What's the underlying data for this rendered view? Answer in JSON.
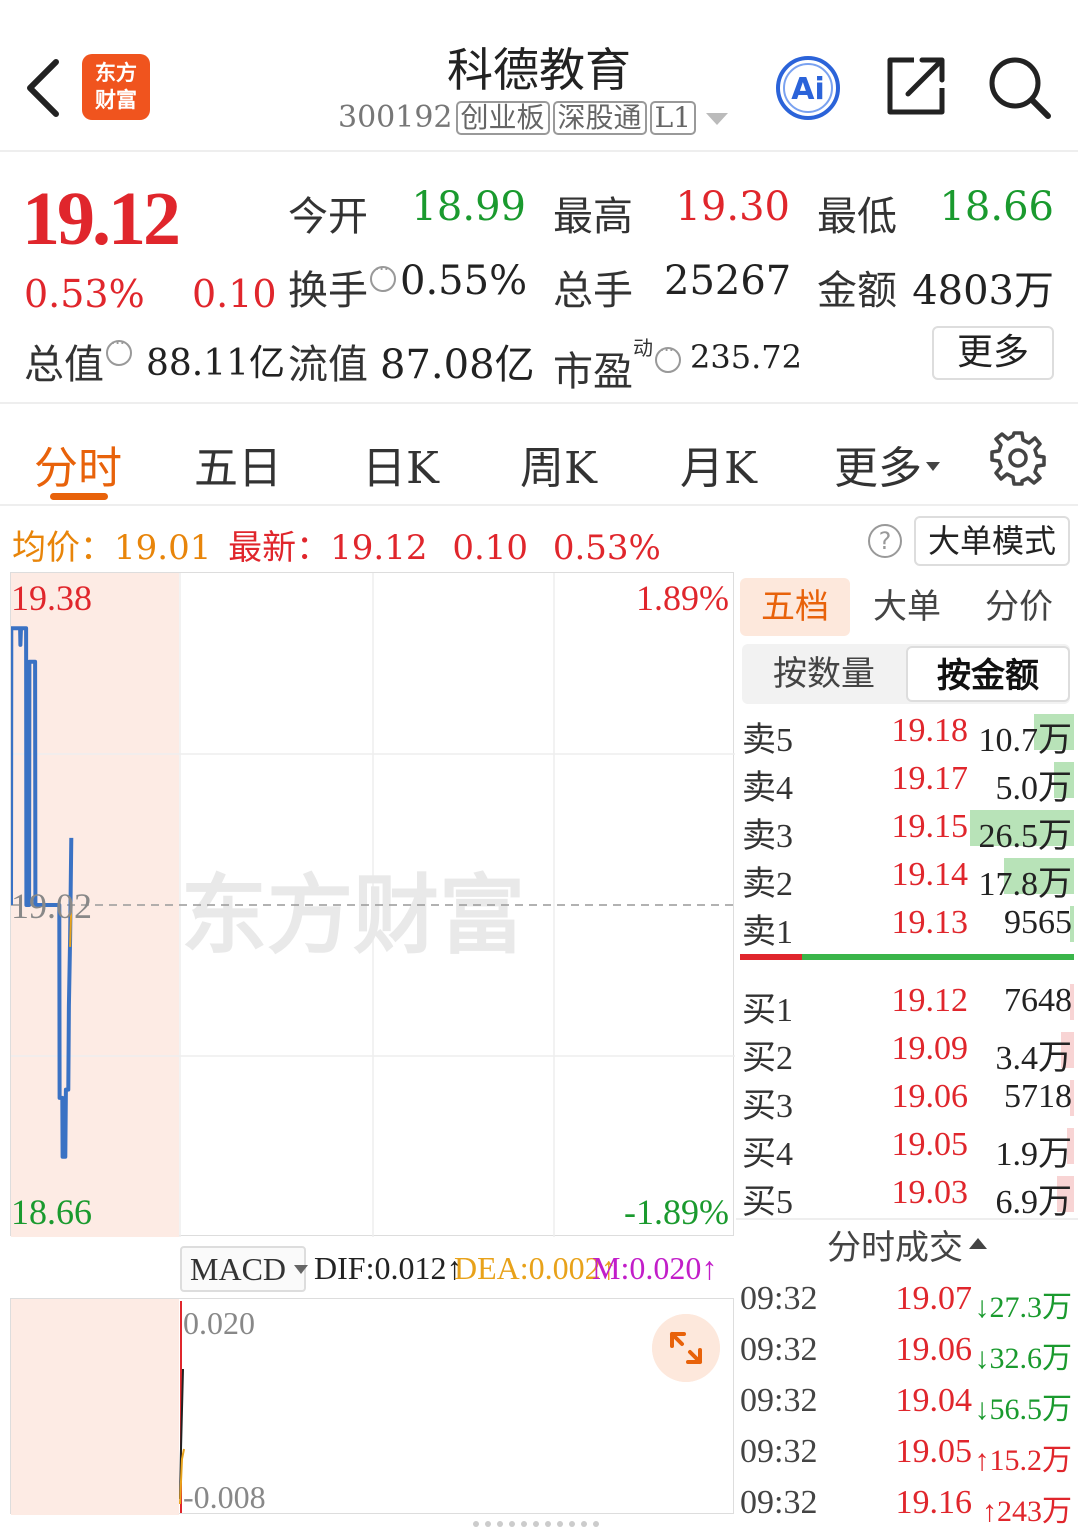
{
  "header": {
    "logo_line1": "东方",
    "logo_line2": "财富",
    "title": "科德教育",
    "code": "300192",
    "tags": [
      "创业板",
      "深股通",
      "L1"
    ],
    "ai_label": "Ai"
  },
  "quote": {
    "price": "19.12",
    "change_pct": "0.53%",
    "change_amt": "0.10",
    "open_label": "今开",
    "open": "18.99",
    "high_label": "最高",
    "high": "19.30",
    "low_label": "最低",
    "low": "18.66",
    "turnover_label": "换手",
    "turnover": "0.55%",
    "volume_label": "总手",
    "volume": "25267",
    "amount_label": "金额",
    "amount": "4803万",
    "mktcap_label": "总值",
    "mktcap": "88.11亿",
    "float_label": "流值",
    "float": "87.08亿",
    "pe_label": "市盈",
    "pe_sup": "动",
    "pe": "235.72",
    "more_label": "更多"
  },
  "tabs": [
    {
      "label": "分时",
      "active": true
    },
    {
      "label": "五日"
    },
    {
      "label": "日K"
    },
    {
      "label": "周K"
    },
    {
      "label": "月K"
    },
    {
      "label": "更多"
    }
  ],
  "infobar": {
    "avg_label": "均价：",
    "avg": "19.01",
    "latest_label": "最新：",
    "latest": "19.12",
    "chg": "0.10",
    "pct": "0.53%",
    "help": "?",
    "mode_button": "大单模式"
  },
  "chart": {
    "watermark": "东方财富",
    "top_price": "19.38",
    "mid_price": "19.02",
    "bottom_price": "18.66",
    "top_pct": "1.89%",
    "bottom_pct": "-1.89%"
  },
  "chart_data": {
    "type": "line",
    "y_range": [
      18.66,
      19.38
    ],
    "prev_close": 19.02,
    "x_range_minutes": [
      0,
      240
    ],
    "series": [
      {
        "values": [
          [
            0,
            19.02
          ],
          [
            0.1,
            19.35
          ],
          [
            3,
            19.35
          ],
          [
            3.1,
            19.33
          ],
          [
            3.3,
            19.35
          ],
          [
            5,
            19.35
          ],
          [
            5.1,
            19.02
          ],
          [
            6,
            19.02
          ],
          [
            6.1,
            19.31
          ],
          [
            8,
            19.31
          ],
          [
            8.1,
            19.02
          ],
          [
            15,
            19.02
          ],
          [
            16,
            19.02
          ],
          [
            16.1,
            18.79
          ],
          [
            17,
            18.79
          ],
          [
            17.1,
            18.72
          ],
          [
            18,
            18.72
          ],
          [
            18.2,
            18.8
          ],
          [
            19,
            18.8
          ],
          [
            19.2,
            18.9
          ],
          [
            19.6,
            18.98
          ],
          [
            20,
            19.1
          ]
        ]
      }
    ]
  },
  "macd": {
    "indicator": "MACD",
    "dif": "DIF:0.012",
    "dea": "DEA:0.002",
    "m": "M:0.020",
    "max_label": "0.020",
    "min_label": "-0.008"
  },
  "right": {
    "tabs": [
      "五档",
      "大单",
      "分价"
    ],
    "modes": [
      "按数量",
      "按金额"
    ],
    "sells": [
      {
        "label": "卖5",
        "price": "19.18",
        "vol": "10.7万",
        "fill": 0.12
      },
      {
        "label": "卖4",
        "price": "19.17",
        "vol": "5.0万",
        "fill": 0.06
      },
      {
        "label": "卖3",
        "price": "19.15",
        "vol": "26.5万",
        "fill": 0.31
      },
      {
        "label": "卖2",
        "price": "19.14",
        "vol": "17.8万",
        "fill": 0.21
      },
      {
        "label": "卖1",
        "price": "19.13",
        "vol": "9565",
        "fill": 0.01
      }
    ],
    "buys": [
      {
        "label": "买1",
        "price": "19.12",
        "vol": "7648",
        "fill": 0.01
      },
      {
        "label": "买2",
        "price": "19.09",
        "vol": "3.4万",
        "fill": 0.04
      },
      {
        "label": "买3",
        "price": "19.06",
        "vol": "5718",
        "fill": 0.01
      },
      {
        "label": "买4",
        "price": "19.05",
        "vol": "1.9万",
        "fill": 0.02
      },
      {
        "label": "买5",
        "price": "19.03",
        "vol": "6.9万",
        "fill": 0.05
      }
    ],
    "trades_title": "分时成交",
    "trades": [
      {
        "time": "09:32",
        "price": "19.07",
        "dir": "down",
        "vol": "27.3万"
      },
      {
        "time": "09:32",
        "price": "19.06",
        "dir": "down",
        "vol": "32.6万"
      },
      {
        "time": "09:32",
        "price": "19.04",
        "dir": "down",
        "vol": "56.5万"
      },
      {
        "time": "09:32",
        "price": "19.05",
        "dir": "up",
        "vol": "15.2万"
      },
      {
        "time": "09:32",
        "price": "19.16",
        "dir": "up",
        "vol": "243万"
      }
    ]
  },
  "colors": {
    "up": "#e0262c",
    "down": "#1a9a2e",
    "accent": "#e8620a",
    "line": "#3a72c4",
    "avg": "#e8a21a"
  }
}
